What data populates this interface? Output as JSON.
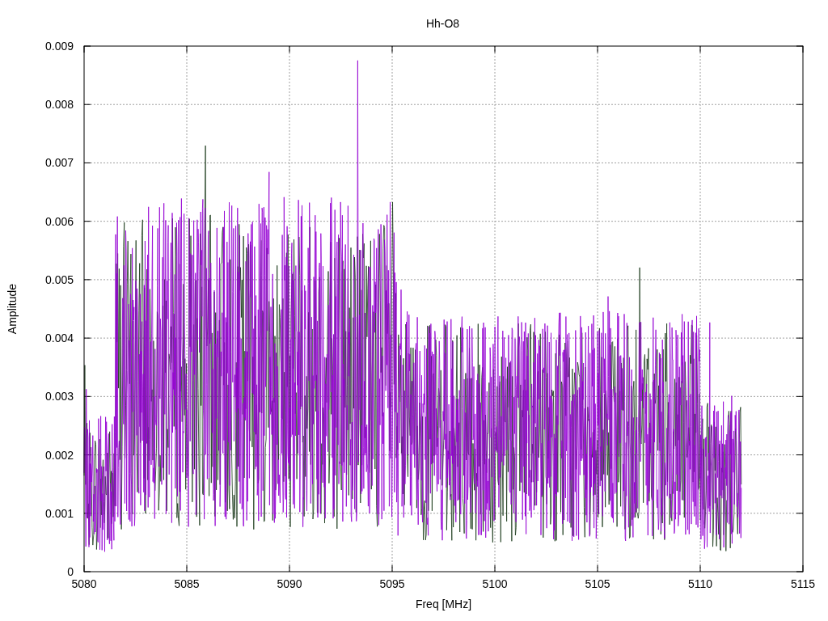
{
  "chart": {
    "title": "Hh-O8",
    "xlabel": "Freq [MHz]",
    "ylabel": "Amplitude",
    "xticks": [
      "5080",
      "5085",
      "5090",
      "5095",
      "5100",
      "5105",
      "5110",
      "5115"
    ],
    "yticks": [
      "0.009",
      "0.008",
      "0.007",
      "0.006",
      "0.005",
      "0.004",
      "0.003",
      "0.002",
      "0.001",
      "0"
    ]
  }
}
